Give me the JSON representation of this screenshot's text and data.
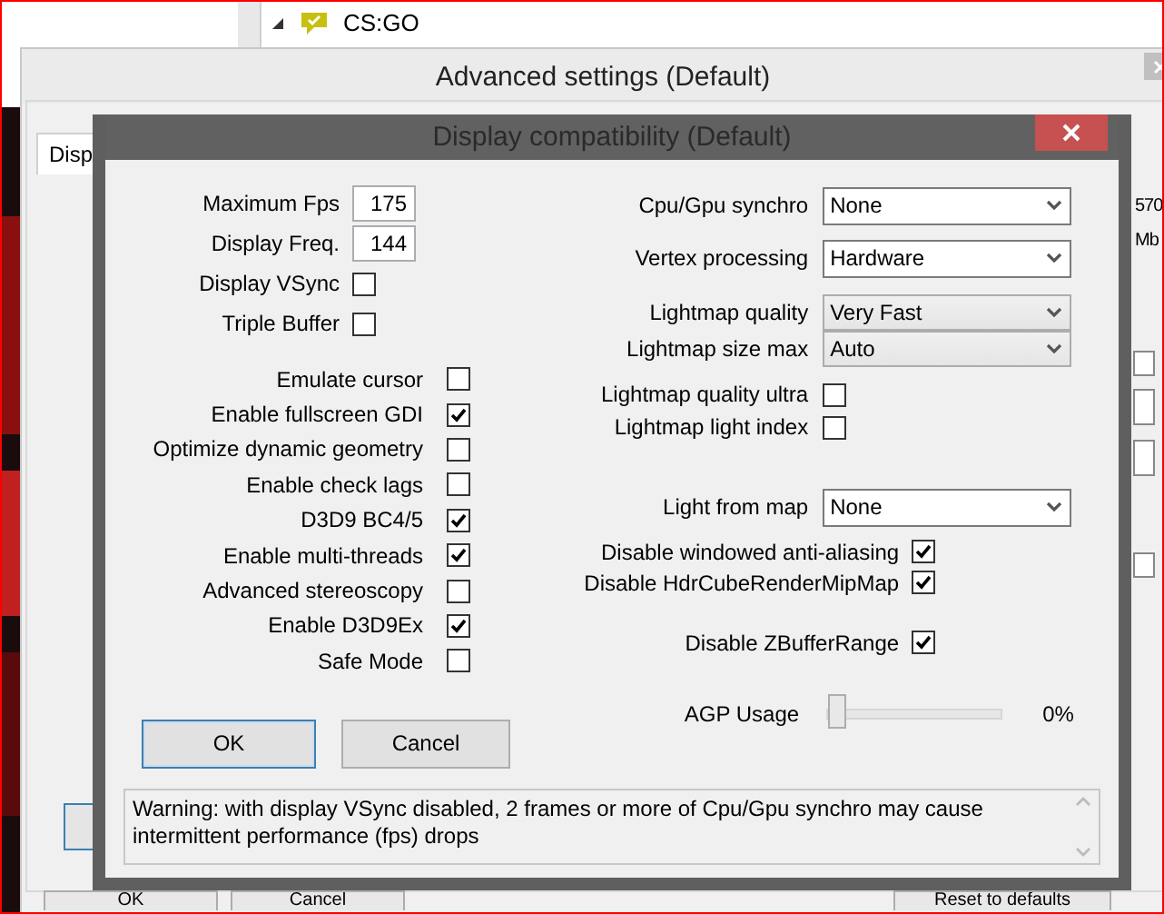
{
  "tree": {
    "label": "CS:GO",
    "expanded": true
  },
  "advanced_window": {
    "title": "Advanced settings (Default)",
    "tab": "Disp",
    "side_texts": [
      "570",
      "Mb"
    ],
    "side_checkboxes": [
      {
        "checked": false
      },
      {
        "checked": false
      }
    ],
    "buttons": [
      "OK",
      "Cancel",
      "Reset to defaults"
    ]
  },
  "dialog": {
    "title": "Display compatibility (Default)",
    "number_fields": [
      {
        "label": "Maximum Fps",
        "value": "175"
      },
      {
        "label": "Display Freq.",
        "value": "144"
      }
    ],
    "display_toggles": [
      {
        "label": "Display VSync",
        "checked": false
      },
      {
        "label": "Triple Buffer",
        "checked": false
      }
    ],
    "options": [
      {
        "label": "Emulate cursor",
        "checked": false
      },
      {
        "label": "Enable fullscreen GDI",
        "checked": true
      },
      {
        "label": "Optimize dynamic geometry",
        "checked": false
      },
      {
        "label": "Enable check lags",
        "checked": false
      },
      {
        "label": "D3D9 BC4/5",
        "checked": true
      },
      {
        "label": "Enable multi-threads",
        "checked": true
      },
      {
        "label": "Advanced stereoscopy",
        "checked": false
      },
      {
        "label": "Enable D3D9Ex",
        "checked": true
      },
      {
        "label": "Safe Mode",
        "checked": false
      }
    ],
    "right_groups": [
      [
        {
          "kind": "select",
          "label": "Cpu/Gpu synchro",
          "value": "None"
        },
        {
          "kind": "select",
          "label": "Vertex processing",
          "value": "Hardware"
        }
      ],
      [
        {
          "kind": "combo",
          "label": "Lightmap quality",
          "value": "Very Fast"
        },
        {
          "kind": "combo",
          "label": "Lightmap size max",
          "value": "Auto"
        }
      ],
      [
        {
          "kind": "checkbox",
          "label": "Lightmap quality ultra",
          "checked": false
        },
        {
          "kind": "checkbox",
          "label": "Lightmap light index",
          "checked": false
        }
      ],
      [
        {
          "kind": "select",
          "label": "Light from map",
          "value": "None"
        }
      ],
      [
        {
          "kind": "wide-checkbox",
          "label": "Disable windowed anti-aliasing",
          "checked": true
        },
        {
          "kind": "wide-checkbox",
          "label": "Disable HdrCubeRenderMipMap",
          "checked": true
        }
      ],
      [
        {
          "kind": "wide-checkbox",
          "label": "Disable ZBufferRange",
          "checked": true
        }
      ]
    ],
    "agp": {
      "label": "AGP Usage",
      "level": 0,
      "reading": "0%"
    },
    "buttons": [
      {
        "label": "OK",
        "selected": true
      },
      {
        "label": "Cancel",
        "selected": false
      }
    ],
    "warning": "Warning: with display VSync disabled, 2 frames or more of Cpu/Gpu synchro may cause intermittent performance (fps) drops"
  }
}
